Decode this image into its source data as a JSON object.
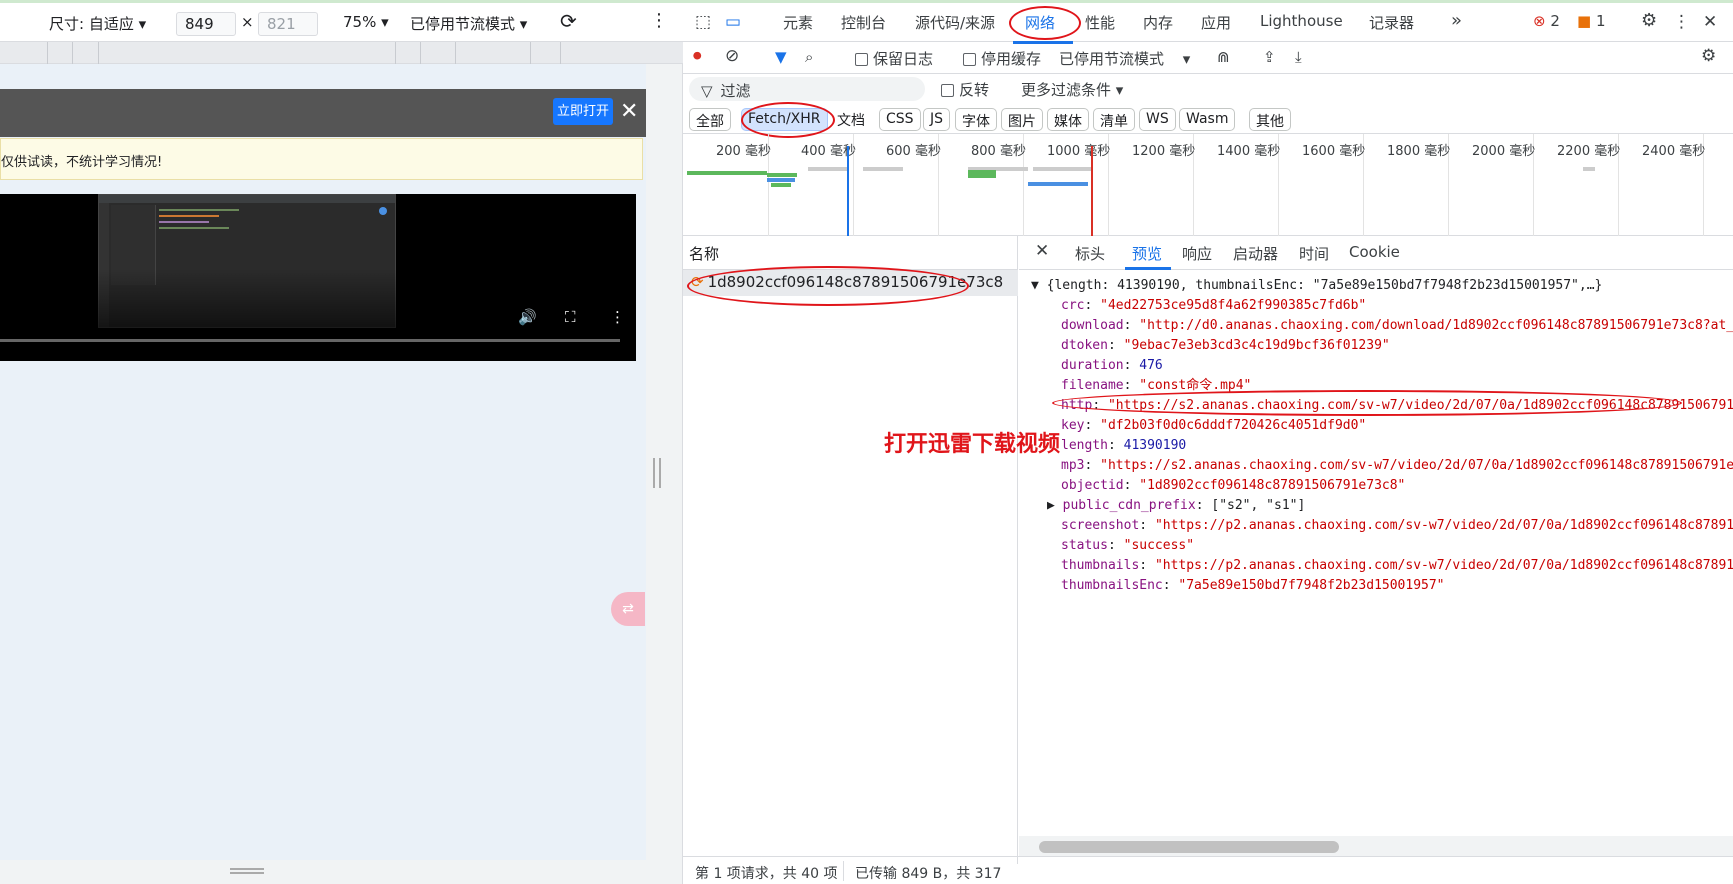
{
  "device_toolbar": {
    "size_label": "尺寸: 自适应 ▾",
    "width": "849",
    "times": "×",
    "height": "821",
    "zoom": "75% ▾",
    "throttle": "已停用节流模式 ▾"
  },
  "page": {
    "open_button": "立即打开",
    "notice": "仅供试读，不统计学习情况!",
    "pink_button": "�"
  },
  "devtools": {
    "tabs": [
      "元素",
      "控制台",
      "源代码/来源",
      "网络",
      "性能",
      "内存",
      "应用",
      "Lighthouse",
      "记录器"
    ],
    "more": "»",
    "errors": "2",
    "warnings": "1",
    "toolbar": {
      "preserve_log": "保留日志",
      "disable_cache": "停用缓存",
      "throttle": "已停用节流模式"
    },
    "filter": {
      "placeholder": "过滤",
      "invert": "反转",
      "more_filters": "更多过滤条件 ▾"
    },
    "types": [
      "全部",
      "Fetch/XHR",
      "文档",
      "CSS",
      "JS",
      "字体",
      "图片",
      "媒体",
      "清单",
      "WS",
      "Wasm",
      "其他"
    ],
    "timeline_ticks": [
      "200 毫秒",
      "400 毫秒",
      "600 毫秒",
      "800 毫秒",
      "1000 毫秒",
      "1200 毫秒",
      "1400 毫秒",
      "1600 毫秒",
      "1800 毫秒",
      "2000 毫秒",
      "2200 毫秒",
      "2400 毫秒"
    ],
    "name_header": "名称",
    "request_name": "1d8902ccf096148c87891506791e73c8",
    "detail_tabs": [
      "标头",
      "预览",
      "响应",
      "启动器",
      "时间",
      "Cookie"
    ],
    "status": {
      "requests": "第 1 项请求，共 40 项",
      "transferred": "已传输 849 B，共 317"
    },
    "preview": {
      "summary": "{length: 41390190, thumbnailsEnc: \"7a5e89e150bd7f7948f2b23d15001957\",…}",
      "rows": [
        {
          "key": "crc",
          "value": "\"4ed22753ce95d8f4a62f990385c7fd6b\"",
          "kind": "s"
        },
        {
          "key": "download",
          "value": "\"http://d0.ananas.chaoxing.com/download/1d8902ccf096148c87891506791e73c8?at_=",
          "kind": "s"
        },
        {
          "key": "dtoken",
          "value": "\"9ebac7e3eb3cd3c4c19d9bcf36f01239\"",
          "kind": "s"
        },
        {
          "key": "duration",
          "value": "476",
          "kind": "n"
        },
        {
          "key": "filename",
          "value": "\"const命令.mp4\"",
          "kind": "s"
        },
        {
          "key": "http",
          "value": "\"https://s2.ananas.chaoxing.com/sv-w7/video/2d/07/0a/1d8902ccf096148c87891506791",
          "kind": "s"
        },
        {
          "key": "key",
          "value": "\"df2b03f0d0c6dddf720426c4051df9d0\"",
          "kind": "s"
        },
        {
          "key": "length",
          "value": "41390190",
          "kind": "n"
        },
        {
          "key": "mp3",
          "value": "\"https://s2.ananas.chaoxing.com/sv-w7/video/2d/07/0a/1d8902ccf096148c87891506791e",
          "kind": "s"
        },
        {
          "key": "objectid",
          "value": "\"1d8902ccf096148c87891506791e73c8\"",
          "kind": "s"
        },
        {
          "key": "public_cdn_prefix",
          "value": "[\"s2\", \"s1\"]",
          "kind": "p"
        },
        {
          "key": "screenshot",
          "value": "\"https://p2.ananas.chaoxing.com/sv-w7/video/2d/07/0a/1d8902ccf096148c878915",
          "kind": "s"
        },
        {
          "key": "status",
          "value": "\"success\"",
          "kind": "s"
        },
        {
          "key": "thumbnails",
          "value": "\"https://p2.ananas.chaoxing.com/sv-w7/video/2d/07/0a/1d8902ccf096148c878915",
          "kind": "s"
        },
        {
          "key": "thumbnailsEnc",
          "value": "\"7a5e89e150bd7f7948f2b23d15001957\"",
          "kind": "s"
        }
      ]
    }
  },
  "annotation": "打开迅雷下载视频",
  "colors": {
    "annotation": "#e0151a",
    "accent": "#1a73e8"
  }
}
